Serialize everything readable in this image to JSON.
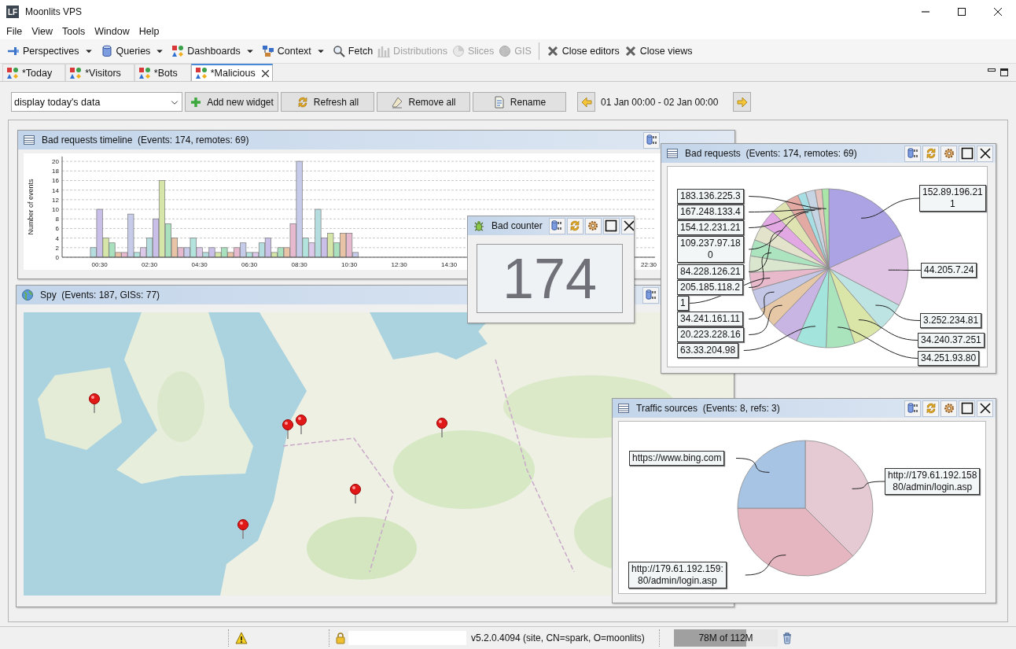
{
  "window": {
    "logo": "LF",
    "title": "Moonlits VPS"
  },
  "menu": [
    "File",
    "View",
    "Tools",
    "Window",
    "Help"
  ],
  "toolbar_groups": [
    {
      "items": [
        {
          "label": "Perspectives",
          "dropdown": true,
          "disabled": false
        },
        {
          "label": "Queries",
          "dropdown": true,
          "disabled": false
        },
        {
          "label": "Dashboards",
          "dropdown": true,
          "disabled": false
        },
        {
          "label": "Context",
          "dropdown": true,
          "disabled": false
        },
        {
          "label": "Fetch",
          "dropdown": false,
          "disabled": false
        },
        {
          "label": "Distributions",
          "dropdown": false,
          "disabled": true
        },
        {
          "label": "Slices",
          "dropdown": false,
          "disabled": true
        },
        {
          "label": "GIS",
          "dropdown": false,
          "disabled": true
        }
      ]
    },
    {
      "items": [
        {
          "label": "Close editors",
          "dropdown": false,
          "disabled": false
        },
        {
          "label": "Close views",
          "dropdown": false,
          "disabled": false
        }
      ]
    }
  ],
  "tabs": [
    {
      "label": "*Today",
      "selected": false
    },
    {
      "label": "*Visitors",
      "selected": false
    },
    {
      "label": "*Bots",
      "selected": false
    },
    {
      "label": "*Malicious",
      "selected": true
    }
  ],
  "dashboard": {
    "selector": "display today's data",
    "buttons": [
      "Add new widget",
      "Refresh all",
      "Remove all",
      "Rename"
    ],
    "range": "01 Jan 00:00 - 02 Jan 00:00"
  },
  "widgets": [
    {
      "kind": "timeline",
      "title": "Bad requests timeline  (Events: 174, remotes: 69)",
      "chart_data": {
        "type": "bar",
        "ylabel": "Number of events",
        "x": [
          0.25,
          0.5,
          0.75,
          1,
          1.25,
          1.5,
          1.75,
          2,
          2.25,
          2.5,
          2.75,
          3,
          3.25,
          3.5,
          3.75,
          4,
          4.25,
          4.5,
          4.75,
          5,
          5.25,
          5.5,
          5.75,
          6,
          6.25,
          6.5,
          6.75,
          7,
          7.25,
          7.5,
          7.75,
          8,
          8.25,
          8.5,
          8.75,
          9,
          9.25,
          9.5,
          9.75,
          10,
          10.25,
          10.5,
          10.75
        ],
        "values": [
          2,
          10,
          4,
          3,
          1,
          1,
          9,
          1,
          2,
          4,
          8,
          16,
          7,
          4,
          2,
          2,
          4,
          2,
          1,
          2,
          1,
          2,
          1,
          2,
          3,
          1,
          1,
          3,
          4,
          1,
          2,
          2,
          7,
          20,
          4,
          3,
          10,
          4,
          5,
          3,
          5,
          5,
          1
        ],
        "xlim": [
          -1,
          22.75
        ],
        "ylim": [
          0,
          21
        ],
        "grid": true,
        "xticks": [
          {
            "value": 0.5,
            "label": "00:30"
          },
          {
            "value": 2.5,
            "label": "02:30"
          },
          {
            "value": 4.5,
            "label": "04:30"
          },
          {
            "value": 6.5,
            "label": "06:30"
          },
          {
            "value": 8.5,
            "label": "08:30"
          },
          {
            "value": 10.5,
            "label": "10:30"
          },
          {
            "value": 12.5,
            "label": "12:30"
          },
          {
            "value": 14.5,
            "label": "14:30"
          },
          {
            "value": 22.5,
            "label": "22:30"
          }
        ],
        "yticks": [
          0,
          2,
          4,
          6,
          8,
          10,
          12,
          14,
          16,
          18,
          20
        ]
      }
    },
    {
      "kind": "map",
      "title": "Spy  (Events: 187, GISs: 77)"
    },
    {
      "kind": "counter",
      "title": "Bad counter",
      "value": "174"
    },
    {
      "kind": "pie",
      "title": "Bad requests  (Events: 174, remotes: 69)",
      "labels": [
        {
          "lines": [
            "183.136.225.3"
          ]
        },
        {
          "lines": [
            "167.248.133.4"
          ]
        },
        {
          "lines": [
            "154.12.231.21"
          ]
        },
        {
          "lines": [
            "109.237.97.18",
            "0"
          ]
        },
        {
          "lines": [
            "84.228.126.21"
          ]
        },
        {
          "lines": [
            "205.185.118.2"
          ]
        },
        {
          "lines": [
            "1"
          ]
        },
        {
          "lines": [
            "34.241.161.11"
          ]
        },
        {
          "lines": [
            "20.223.228.16"
          ]
        },
        {
          "lines": [
            "63.33.204.98"
          ]
        },
        {
          "lines": [
            "152.89.196.21",
            "1"
          ]
        },
        {
          "lines": [
            "44.205.7.24"
          ]
        },
        {
          "lines": [
            "3.252.234.81"
          ]
        },
        {
          "lines": [
            "34.240.37.251"
          ]
        },
        {
          "lines": [
            "34.251.93.80"
          ]
        }
      ]
    },
    {
      "kind": "pie",
      "title": "Traffic sources  (Events: 8, refs: 3)",
      "labels": [
        {
          "lines": [
            "https://www.bing.com"
          ]
        },
        {
          "lines": [
            "http://179.61.192.158",
            "80/admin/login.asp"
          ]
        },
        {
          "lines": [
            "http://179.61.192.159:",
            "80/admin/login.asp"
          ]
        }
      ]
    }
  ],
  "status_bar": {
    "version": "v5.2.0.4094 (site, CN=spark, O=moonlits)",
    "memory": {
      "label": "78M of 112M",
      "level": 0.7
    }
  }
}
